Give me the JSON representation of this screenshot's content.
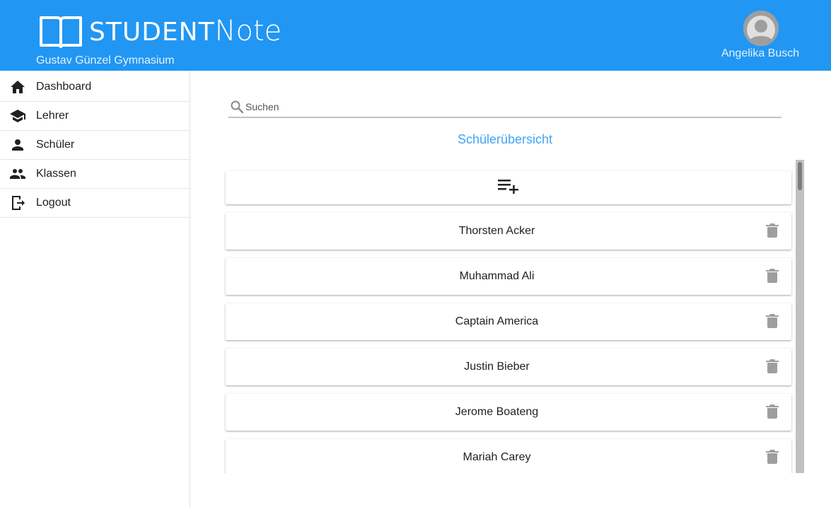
{
  "app": {
    "brand_part1": "STUDENT",
    "brand_part2": "Note",
    "school": "Gustav Günzel Gymnasium",
    "user": "Angelika Busch",
    "accent_color": "#2196f3"
  },
  "sidebar": {
    "items": [
      {
        "label": "Dashboard",
        "icon": "home-icon"
      },
      {
        "label": "Lehrer",
        "icon": "school-icon"
      },
      {
        "label": "Schüler",
        "icon": "person-icon"
      },
      {
        "label": "Klassen",
        "icon": "people-icon"
      },
      {
        "label": "Logout",
        "icon": "logout-icon"
      }
    ]
  },
  "search": {
    "placeholder": "Suchen",
    "value": ""
  },
  "main": {
    "title": "Schülerübersicht",
    "add_icon": "playlist-add-icon",
    "students": [
      {
        "name": "Thorsten Acker"
      },
      {
        "name": "Muhammad Ali"
      },
      {
        "name": "Captain America"
      },
      {
        "name": "Justin Bieber"
      },
      {
        "name": "Jerome Boateng"
      },
      {
        "name": "Mariah Carey"
      }
    ]
  }
}
